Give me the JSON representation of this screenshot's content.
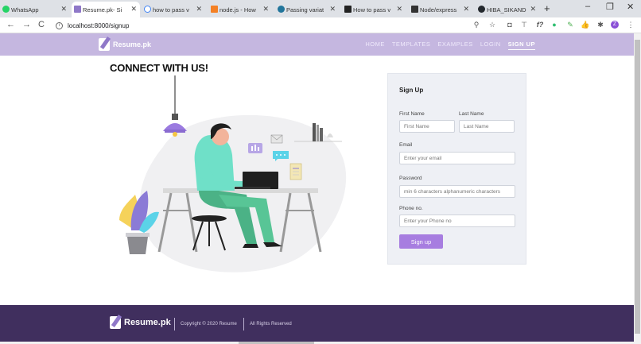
{
  "browser": {
    "tabs": [
      {
        "label": "WhatsApp",
        "icon": "whatsapp-icon",
        "color": "#25d366"
      },
      {
        "label": "Resume.pk- Si",
        "icon": "feather-icon",
        "color": "#8f78c8"
      },
      {
        "label": "how to pass v",
        "icon": "google-icon",
        "color": "#4285f4"
      },
      {
        "label": "node.js - How",
        "icon": "stackoverflow-icon",
        "color": "#f48024"
      },
      {
        "label": "Passing variat",
        "icon": "wordpress-icon",
        "color": "#21759b"
      },
      {
        "label": "How to pass v",
        "icon": "r-icon",
        "color": "#222222"
      },
      {
        "label": "Node/express",
        "icon": "bolt-icon",
        "color": "#333333"
      },
      {
        "label": "HIBA_SIKAND",
        "icon": "github-icon",
        "color": "#24292e"
      }
    ],
    "new_tab": "+",
    "window_controls": [
      "–",
      "❐",
      "✕"
    ],
    "url": "localhost:8000/signup",
    "url_info": "i",
    "nav_back": "←",
    "nav_forward": "→",
    "nav_reload": "C",
    "extensions": [
      "⚲",
      "☆",
      "◘",
      "⊤",
      "f?",
      "●",
      "✎",
      "👍",
      "✱",
      "Z",
      "⋮"
    ]
  },
  "site": {
    "brand": "Resume.pk",
    "menu": [
      "HOME",
      "TEMPLATES",
      "EXAMPLES",
      "LOGIN",
      "SIGN UP"
    ],
    "active_menu": "SIGN UP",
    "heading": "CONNECT WITH US!",
    "accent_color": "#a77de0",
    "navbar_color": "#c5b7e0",
    "footer_color": "#402f5e"
  },
  "signup": {
    "title": "Sign Up",
    "first_name_label": "First Name",
    "first_name_placeholder": "First Name",
    "last_name_label": "Last Name",
    "last_name_placeholder": "Last Name",
    "email_label": "Email",
    "email_placeholder": "Enter your email",
    "password_label": "Password",
    "password_placeholder": "min 6 characters alphanumeric characters",
    "phone_label": "Phone no.",
    "phone_placeholder": "Enter your Phone no",
    "submit_label": "Sign up"
  },
  "footer": {
    "brand": "Resume.pk",
    "copyright": "Copyright © 2020 Resume",
    "rights": "All Rights Reserved"
  }
}
